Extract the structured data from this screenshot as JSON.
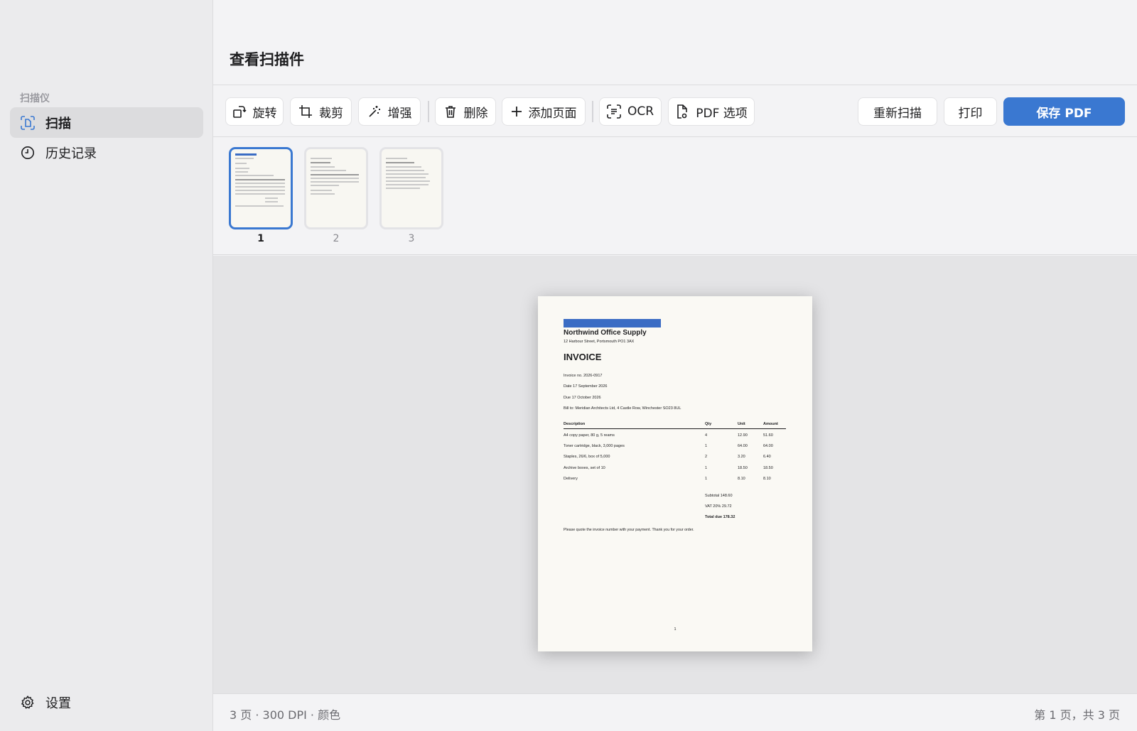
{
  "sidebar": {
    "section_label": "扫描仪",
    "items": [
      {
        "label": "扫描",
        "icon": "scan-document-icon",
        "active": true
      },
      {
        "label": "历史记录",
        "icon": "clock-icon",
        "active": false
      }
    ],
    "settings_label": "设置"
  },
  "header": {
    "title": "查看扫描件"
  },
  "toolbar": {
    "rotate": "旋转",
    "crop": "裁剪",
    "enhance": "增强",
    "delete": "删除",
    "add_page": "添加页面",
    "ocr": "OCR",
    "pdf_options": "PDF 选项",
    "rescan": "重新扫描",
    "print": "打印",
    "save_pdf": "保存 PDF"
  },
  "thumbnails": [
    {
      "number": "1",
      "selected": true
    },
    {
      "number": "2",
      "selected": false
    },
    {
      "number": "3",
      "selected": false
    }
  ],
  "document": {
    "company": "Northwind Office Supply",
    "address": "12 Harbour Street, Portsmouth PO1 3AX",
    "title": "INVOICE",
    "invoice_no": "Invoice no. 2026-0917",
    "date": "Date 17 September 2026",
    "due": "Due 17 October 2026",
    "bill_to": "Bill to: Meridian Architects Ltd, 4 Castle Row, Winchester SO23 8UL",
    "columns": [
      "Description",
      "Qty",
      "Unit",
      "Amount"
    ],
    "rows": [
      [
        "A4 copy paper, 80 g, 5 reams",
        "4",
        "12.90",
        "51.60"
      ],
      [
        "Toner cartridge, black, 3,000 pages",
        "1",
        "64.00",
        "64.00"
      ],
      [
        "Staples, 26/6, box of 5,000",
        "2",
        "3.20",
        "6.40"
      ],
      [
        "Archive boxes, set of 10",
        "1",
        "18.50",
        "18.50"
      ],
      [
        "Delivery",
        "1",
        "8.10",
        "8.10"
      ]
    ],
    "subtotal": "Subtotal 148.60",
    "vat": "VAT 20% 29.72",
    "total": "Total due 178.32",
    "note": "Please quote the invoice number with your payment. Thank you for your order.",
    "page_number": "1"
  },
  "footer": {
    "info": "3 页 · 300 DPI · 颜色",
    "page_status": "第 1 页，共 3 页"
  },
  "colors": {
    "accent": "#3a78d1",
    "invoice_bar": "#3a6cc4"
  }
}
